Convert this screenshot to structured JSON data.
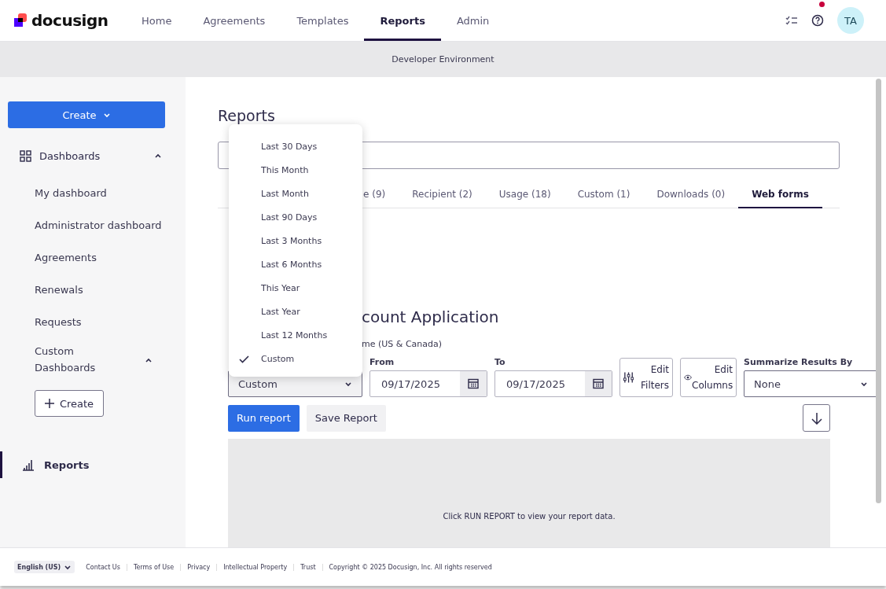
{
  "brand": "docusign",
  "nav": [
    {
      "label": "Home",
      "selected": false
    },
    {
      "label": "Agreements",
      "selected": false
    },
    {
      "label": "Templates",
      "selected": false
    },
    {
      "label": "Reports",
      "selected": true
    },
    {
      "label": "Admin",
      "selected": false
    }
  ],
  "has_notification": true,
  "avatar": "TA",
  "banner": "Developer Environment",
  "sidebar": {
    "create": "Create",
    "dashboards": {
      "label": "Dashboards",
      "expanded": true,
      "children": [
        {
          "label": "My dashboard"
        },
        {
          "label": "Administrator dashboard"
        },
        {
          "label": "Agreements"
        },
        {
          "label": "Renewals"
        },
        {
          "label": "Requests"
        }
      ]
    },
    "custom": {
      "label": "Custom Dashboards",
      "expanded": true
    },
    "add_button": "Create",
    "reports": {
      "label": "Reports",
      "selected": true
    }
  },
  "main": {
    "heading": "Reports",
    "tabs": [
      {
        "label": "e (9)",
        "selected": false
      },
      {
        "label": "Recipient (2)",
        "selected": false
      },
      {
        "label": "Usage (18)",
        "selected": false
      },
      {
        "label": "Custom (1)",
        "selected": false
      },
      {
        "label": "Downloads (0)",
        "selected": false
      },
      {
        "label": "Web forms",
        "selected": true
      }
    ],
    "report_title": "count Application",
    "timezone": "me (US & Canada)",
    "date_range": {
      "value": "Custom",
      "options": [
        {
          "label": "Last 30 Days",
          "selected": false
        },
        {
          "label": "This Month",
          "selected": false
        },
        {
          "label": "Last Month",
          "selected": false
        },
        {
          "label": "Last 90 Days",
          "selected": false
        },
        {
          "label": "Last 3 Months",
          "selected": false
        },
        {
          "label": "Last 6 Months",
          "selected": false
        },
        {
          "label": "This Year",
          "selected": false
        },
        {
          "label": "Last Year",
          "selected": false
        },
        {
          "label": "Last 12 Months",
          "selected": false
        },
        {
          "label": "Custom",
          "selected": true
        }
      ]
    },
    "from": {
      "label": "From",
      "value": "09/17/2025"
    },
    "to": {
      "label": "To",
      "value": "09/17/2025"
    },
    "edit_filters": "Edit Filters",
    "edit_columns": "Edit Columns",
    "summarize": {
      "label": "Summarize Results By",
      "value": "None"
    },
    "run_button": "Run report",
    "save_button": "Save Report",
    "empty_message": "Click RUN REPORT to view your report data."
  },
  "footer": {
    "language": "English (US)",
    "links": [
      "Contact Us",
      "Terms of Use",
      "Privacy",
      "Intellectual Property",
      "Trust"
    ],
    "copyright": "Copyright © 2025 Docusign, Inc. All rights reserved"
  }
}
